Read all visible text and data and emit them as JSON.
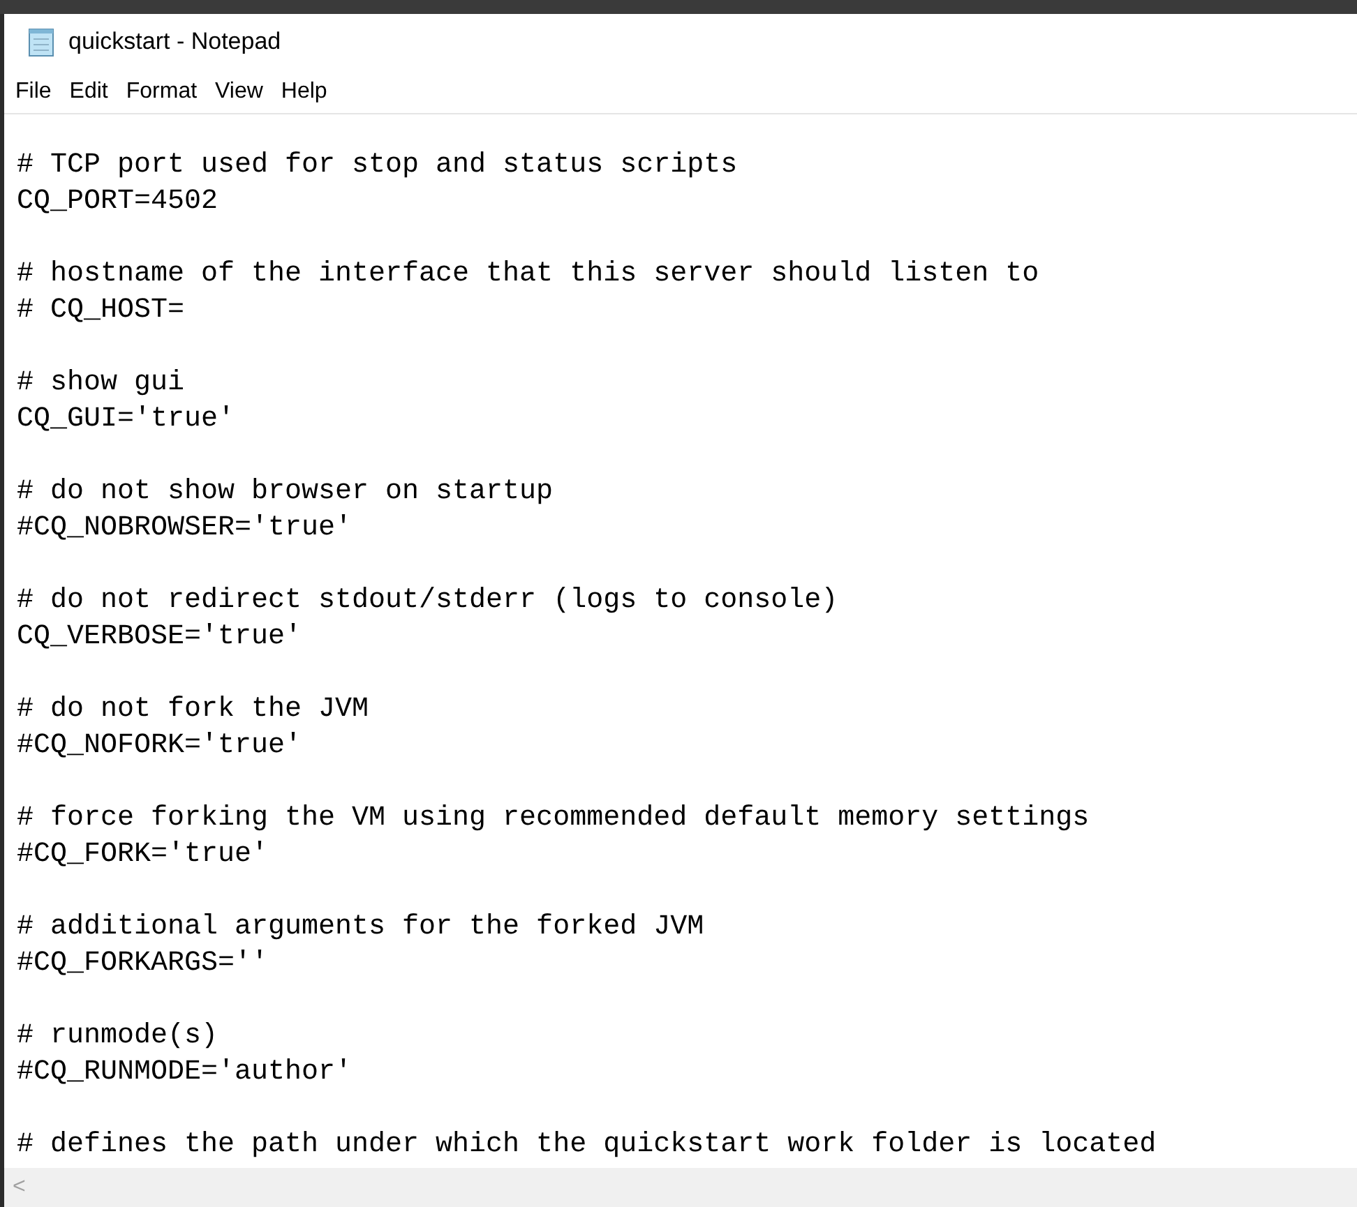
{
  "window": {
    "title": "quickstart - Notepad"
  },
  "menu": [
    "File",
    "Edit",
    "Format",
    "View",
    "Help"
  ],
  "editor": {
    "blocks": [
      [
        "# TCP port used for stop and status scripts",
        "CQ_PORT=4502"
      ],
      [
        "# hostname of the interface that this server should listen to",
        "# CQ_HOST="
      ],
      [
        "# show gui",
        "CQ_GUI='true'"
      ],
      [
        "# do not show browser on startup",
        "#CQ_NOBROWSER='true'"
      ],
      [
        "# do not redirect stdout/stderr (logs to console)",
        "CQ_VERBOSE='true'"
      ],
      [
        "# do not fork the JVM",
        "#CQ_NOFORK='true'"
      ],
      [
        "# force forking the VM using recommended default memory settings",
        "#CQ_FORK='true'"
      ],
      [
        "# additional arguments for the forked JVM",
        "#CQ_FORKARGS=''"
      ],
      [
        "# runmode(s)",
        "#CQ_RUNMODE='author'"
      ],
      [
        "# defines the path under which the quickstart work folder is located"
      ]
    ]
  },
  "scrollbar": {
    "left_arrow": "<"
  }
}
